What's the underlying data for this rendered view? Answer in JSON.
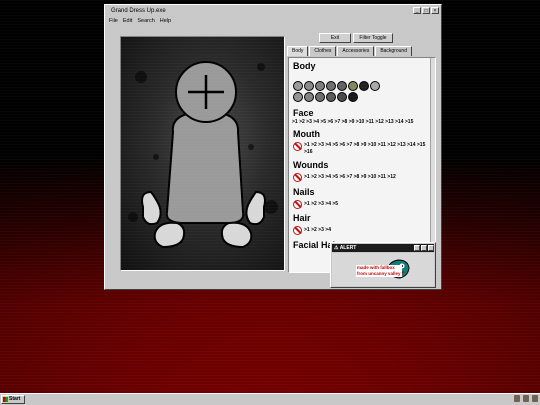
{
  "window": {
    "title": "Grand Dress Up.exe",
    "controls": [
      "_",
      "□",
      "×"
    ]
  },
  "menu": [
    "File",
    "Edit",
    "Search",
    "Help"
  ],
  "toolbar": {
    "exit_label": "Exit",
    "filter_label": "Filter Toggle"
  },
  "tabs": [
    {
      "label": "Body",
      "active": true
    },
    {
      "label": "Clothes"
    },
    {
      "label": "Accessories"
    },
    {
      "label": "Background"
    }
  ],
  "panel": {
    "body": {
      "title": "Body",
      "swatches": [
        "#9a9a9a",
        "#8a8a8a",
        "#7e7e7e",
        "#707070",
        "#626262",
        "#7d8a5c",
        "#222222",
        "#a8a8a8",
        "#949494",
        "#828282",
        "#6e6e6e",
        "#5a5a5a",
        "#4a4a4a",
        "#1a1a1a"
      ]
    },
    "face": {
      "title": "Face",
      "options": ">1 >2 >3 >4 >5 >6 >7 >8 >9 >10 >11 >12 >13 >14 >15"
    },
    "mouth": {
      "title": "Mouth",
      "options": ">1 >2 >3 >4 >5 >6 >7 >8 >9 >10 >11 >12 >13 >14 >15 >16"
    },
    "wounds": {
      "title": "Wounds",
      "options": ">1 >2 >3 >4 >5 >6 >7 >8 >9 >10 >11 >12"
    },
    "nails": {
      "title": "Nails",
      "options": ">1 >2 >3 >4 >5"
    },
    "hair": {
      "title": "Hair",
      "options": ">1 >2 >3 >4"
    },
    "facial_hair": {
      "title": "Facial Hair"
    }
  },
  "alert": {
    "title": "ALERT",
    "credit": "made with fallbox\nfrom uncanny valley"
  },
  "taskbar": {
    "start_label": "Start"
  },
  "colors": {
    "window": "#c8c8c8",
    "error_red": "#c01010",
    "desktop_red": "#8a0000"
  }
}
